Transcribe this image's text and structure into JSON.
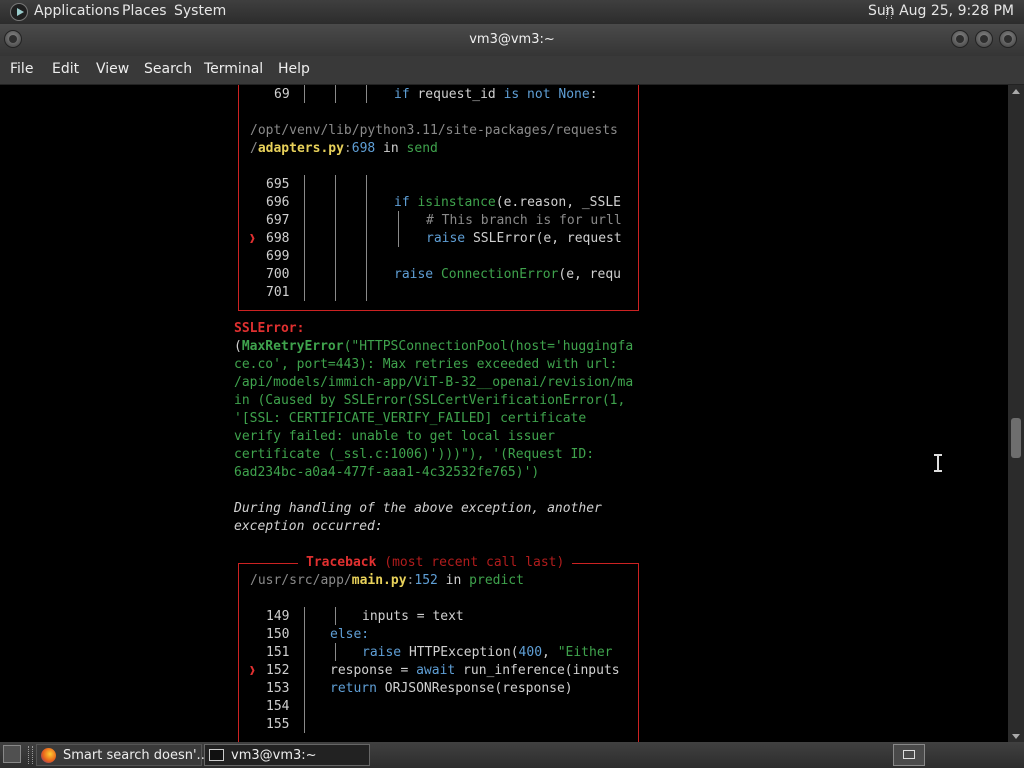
{
  "top_panel": {
    "menus": [
      "Applications",
      "Places",
      "System"
    ],
    "clock": "Sun Aug 25,  9:28 PM"
  },
  "window": {
    "title": "vm3@vm3:~"
  },
  "menubar": [
    "File",
    "Edit",
    "View",
    "Search",
    "Terminal",
    "Help"
  ],
  "terminal": {
    "block1": {
      "line69_no": "69",
      "line69_code": "if request_id is not None:",
      "path_prefix": "/opt/venv/lib/python3.11/site-packages/requests",
      "path_file_slash": "/",
      "path_file": "adapters.py",
      "path_colon": ":",
      "path_line": "698",
      "path_in": " in ",
      "path_func": "send",
      "lines": [
        {
          "no": "695",
          "code": ""
        },
        {
          "no": "696",
          "code": "if isinstance(e.reason, _SSLE"
        },
        {
          "no": "697",
          "code": "# This branch is for urll"
        },
        {
          "no": "698",
          "code": "raise SSLError(e, request"
        },
        {
          "no": "699",
          "code": ""
        },
        {
          "no": "700",
          "code": "raise ConnectionError(e, requ"
        },
        {
          "no": "701",
          "code": ""
        }
      ],
      "marker": "❱"
    },
    "error": {
      "name": "SSLError:",
      "open_paren": "(",
      "exc": "MaxRetryError",
      "lines": [
        "(\"HTTPSConnectionPool(host='huggingfa",
        "ce.co', port=443): Max retries exceeded with url:",
        "/api/models/immich-app/ViT-B-32__openai/revision/ma",
        "in (Caused by SSLError(SSLCertVerificationError(1,",
        "'[SSL: CERTIFICATE_VERIFY_FAILED] certificate",
        "verify failed: unable to get local issuer",
        "certificate (_ssl.c:1006)')))\"), '(Request ID:",
        "6ad234bc-a0a4-477f-aaa1-4c32532fe765)')"
      ]
    },
    "during": [
      "During handling of the above exception, another",
      "exception occurred:"
    ],
    "traceback": {
      "title": "Traceback",
      "subtitle": "(most recent call last)",
      "path_prefix": "/usr/src/app/",
      "path_file": "main.py",
      "path_colon": ":",
      "path_line": "152",
      "path_in": " in ",
      "path_func": "predict",
      "lines": [
        {
          "no": "149",
          "code": "inputs = text"
        },
        {
          "no": "150",
          "code": "else:"
        },
        {
          "no": "151",
          "code": "raise HTTPException(400, \"Either"
        },
        {
          "no": "152",
          "code": "response = await run_inference(inputs"
        },
        {
          "no": "153",
          "code": "return ORJSONResponse(response)"
        },
        {
          "no": "154",
          "code": ""
        },
        {
          "no": "155",
          "code": ""
        }
      ]
    }
  },
  "taskbar": {
    "tasks": [
      {
        "label": "Smart search doesn'..."
      },
      {
        "label": "vm3@vm3:~"
      }
    ]
  },
  "colors": {
    "border_red": "#cc2222",
    "string_green": "#3fa34d",
    "keyword_blue": "#5f9fd6",
    "filename_yellow": "#e8d15a"
  }
}
